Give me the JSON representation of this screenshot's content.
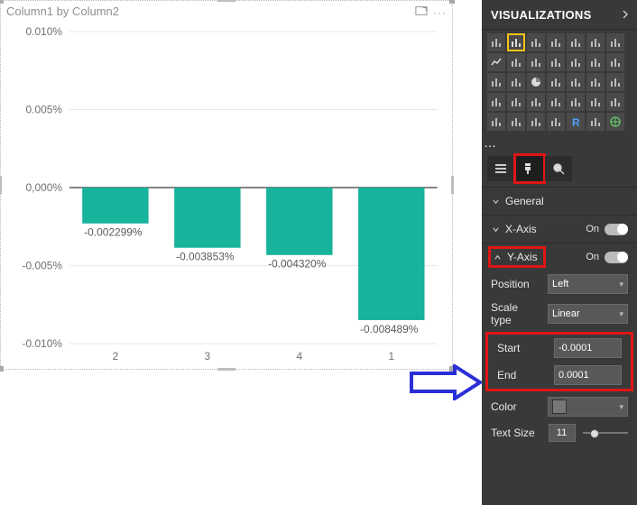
{
  "chart": {
    "title": "Column1 by Column2"
  },
  "chart_data": {
    "type": "bar",
    "title": "Column1 by Column2",
    "xlabel": "",
    "ylabel": "",
    "ylim": [
      -0.01,
      0.01
    ],
    "ytick_labels": [
      "0.010%",
      "0.005%",
      "0,000%",
      "-0.005%",
      "-0.010%"
    ],
    "ytick_values": [
      0.01,
      0.005,
      0.0,
      -0.005,
      -0.01
    ],
    "categories": [
      "2",
      "3",
      "4",
      "1"
    ],
    "values": [
      -0.002299,
      -0.003853,
      -0.00432,
      -0.008489
    ],
    "value_labels": [
      "-0.002299%",
      "-0.003853%",
      "-0.004320%",
      "-0.008489%"
    ],
    "bar_color": "#17b39a",
    "baseline_color": "#5c5c5c"
  },
  "panel": {
    "title": "VISUALIZATIONS",
    "gallery_icons": [
      "stacked-bar-h",
      "clustered-column",
      "stacked-column",
      "stacked-100-column",
      "clustered-bar-h",
      "stacked-bar-100-h",
      "ribbon",
      "line",
      "area",
      "stacked-area",
      "line-clustered",
      "line-stacked",
      "waterfall",
      "combo",
      "scatter",
      "bubble",
      "pie",
      "donut",
      "treemap",
      "map",
      "filled-map",
      "funnel",
      "gauge",
      "card",
      "multi-row-card",
      "kpi",
      "slicer",
      "table",
      "matrix",
      "table2",
      "table3",
      "arcgis",
      "r-visual",
      "py-visual",
      "globe"
    ],
    "tabs": [
      "fields",
      "format",
      "analytics"
    ],
    "sections": {
      "general": "General",
      "xaxis": {
        "label": "X-Axis",
        "state": "On"
      },
      "yaxis": {
        "label": "Y-Axis",
        "state": "On",
        "position_label": "Position",
        "position_value": "Left",
        "scale_label": "Scale type",
        "scale_value": "Linear",
        "start_label": "Start",
        "start_value": "-0.0001",
        "end_label": "End",
        "end_value": "0.0001",
        "color_label": "Color",
        "textsize_label": "Text Size",
        "textsize_value": "11"
      }
    }
  }
}
